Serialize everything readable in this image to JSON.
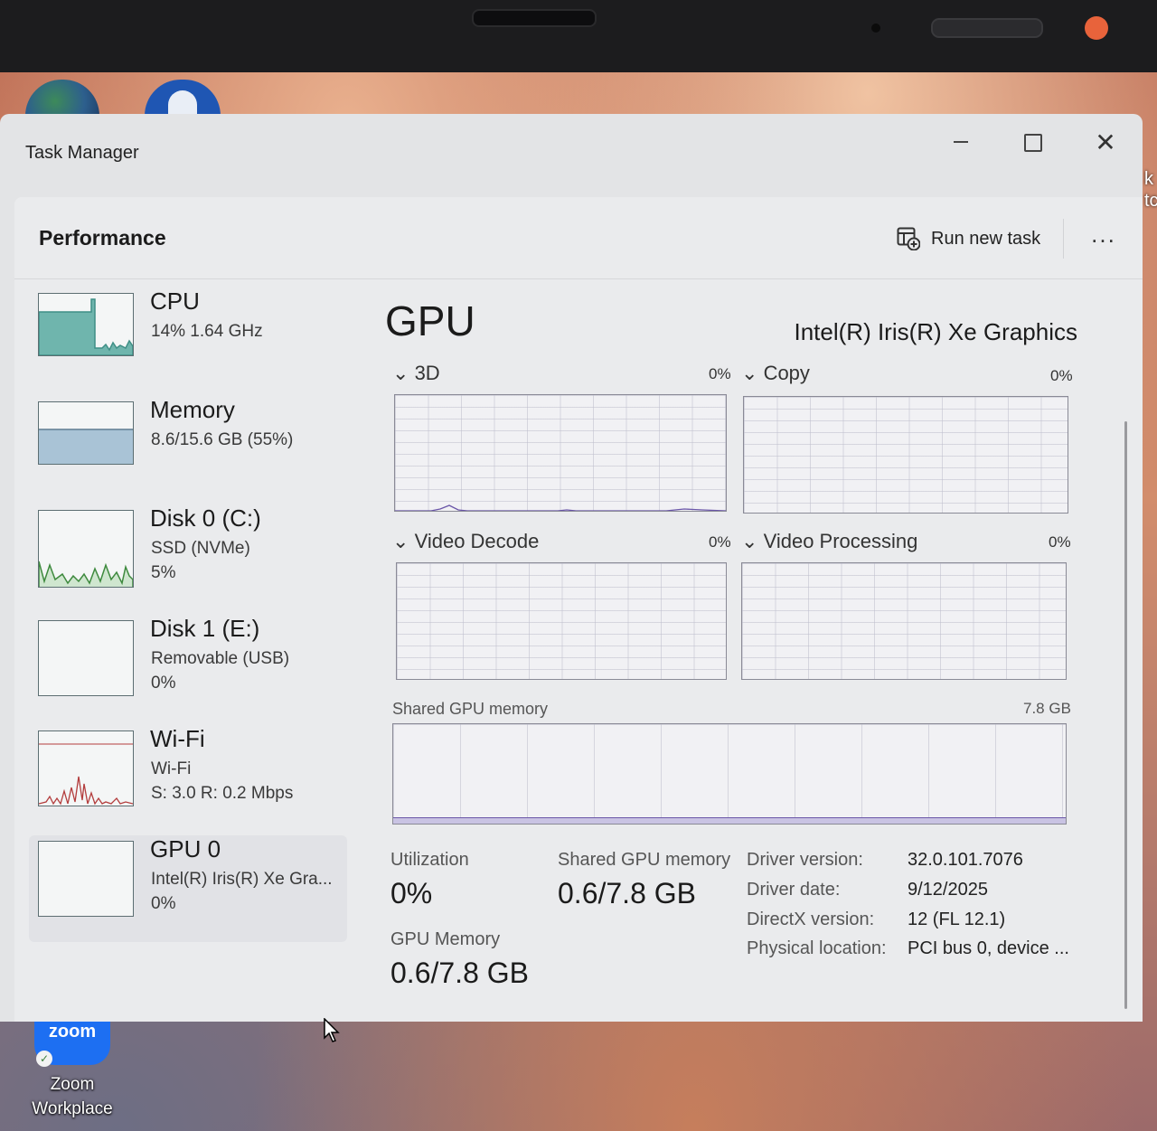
{
  "window": {
    "title": "Task Manager"
  },
  "header": {
    "page_title": "Performance",
    "run_new_task": "Run new task",
    "more": "..."
  },
  "sidebar": {
    "devices": [
      {
        "name": "CPU",
        "line1": "14%  1.64 GHz",
        "line2": ""
      },
      {
        "name": "Memory",
        "line1": "8.6/15.6 GB (55%)",
        "line2": ""
      },
      {
        "name": "Disk 0 (C:)",
        "line1": "SSD (NVMe)",
        "line2": "5%"
      },
      {
        "name": "Disk 1 (E:)",
        "line1": "Removable (USB)",
        "line2": "0%"
      },
      {
        "name": "Wi-Fi",
        "line1": "Wi-Fi",
        "line2": "S: 3.0  R: 0.2 Mbps"
      },
      {
        "name": "GPU 0",
        "line1": "Intel(R) Iris(R) Xe Gra...",
        "line2": "0%"
      }
    ]
  },
  "gpu": {
    "title": "GPU",
    "model": "Intel(R) Iris(R) Xe Graphics",
    "engines": [
      {
        "label": "3D",
        "pct": "0%"
      },
      {
        "label": "Copy",
        "pct": "0%"
      },
      {
        "label": "Video Decode",
        "pct": "0%"
      },
      {
        "label": "Video Processing",
        "pct": "0%"
      }
    ],
    "shared_memory_graph": {
      "label": "Shared GPU memory",
      "max": "7.8 GB"
    },
    "stats": {
      "utilization_label": "Utilization",
      "utilization_value": "0%",
      "shared_label": "Shared GPU memory",
      "shared_value": "0.6/7.8 GB",
      "gpu_memory_label": "GPU Memory",
      "gpu_memory_value": "0.6/7.8 GB"
    },
    "details": [
      {
        "key": "Driver version:",
        "value": "32.0.101.7076"
      },
      {
        "key": "Driver date:",
        "value": "9/12/2025"
      },
      {
        "key": "DirectX version:",
        "value": "12 (FL 12.1)"
      },
      {
        "key": "Physical location:",
        "value": "PCI bus 0, device ..."
      }
    ]
  },
  "desktop": {
    "zoom_logo": "zoom",
    "zoom_label_1": "Zoom",
    "zoom_label_2": "Workplace",
    "edge_text_1": "k",
    "edge_text_2": "tc"
  },
  "colors": {
    "cpu_fill": "#6fb5ad",
    "memory_fill": "#a9c3d6",
    "disk_line": "#3e8a3e",
    "wifi_line": "#b33d3d",
    "gpu_line": "#6a56a8"
  }
}
